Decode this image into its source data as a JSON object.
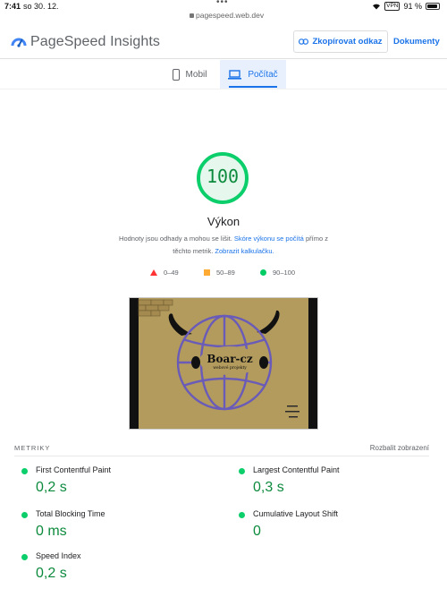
{
  "status_bar": {
    "time": "7:41",
    "date": "so 30. 12.",
    "url": "pagespeed.web.dev",
    "vpn": "VPN",
    "battery": "91 %"
  },
  "header": {
    "brand": "PageSpeed Insights",
    "copy_link_label": "Zkopírovat odkaz",
    "docs_label": "Dokumenty"
  },
  "tabs": [
    {
      "label": "Mobil",
      "icon": "phone-icon",
      "active": false
    },
    {
      "label": "Počítač",
      "icon": "laptop-icon",
      "active": true
    }
  ],
  "score": {
    "value": "100",
    "value_number": 100,
    "category": "Výkon",
    "description_1": "Hodnoty jsou odhady a mohou se lišit.",
    "description_link_1": "Skóre výkonu se počítá",
    "description_2": "přímo z těchto metrik.",
    "description_link_2": "Zobrazit kalkulačku."
  },
  "legend": [
    {
      "range": "0–49",
      "icon": "triangle-icon",
      "color": "#ff3333"
    },
    {
      "range": "50–89",
      "icon": "square-icon",
      "color": "#ffaa33"
    },
    {
      "range": "90–100",
      "icon": "circle-icon",
      "color": "#00cc66"
    }
  ],
  "screenshot": {
    "logo_text": "Boar-cz",
    "logo_subtitle": "webové projekty"
  },
  "metrics": {
    "heading": "METRIKY",
    "expand_label": "Rozbalit zobrazení",
    "items": [
      {
        "label": "First Contentful Paint",
        "value": "0,2 s"
      },
      {
        "label": "Largest Contentful Paint",
        "value": "0,3 s"
      },
      {
        "label": "Total Blocking Time",
        "value": "0 ms"
      },
      {
        "label": "Cumulative Layout Shift",
        "value": "0"
      },
      {
        "label": "Speed Index",
        "value": "0,2 s"
      }
    ]
  },
  "colors": {
    "accent": "#1a73e8",
    "pass": "#0cce6b",
    "pass_text": "#0c8a3d",
    "tab_active_bg": "#e8f0fe"
  }
}
